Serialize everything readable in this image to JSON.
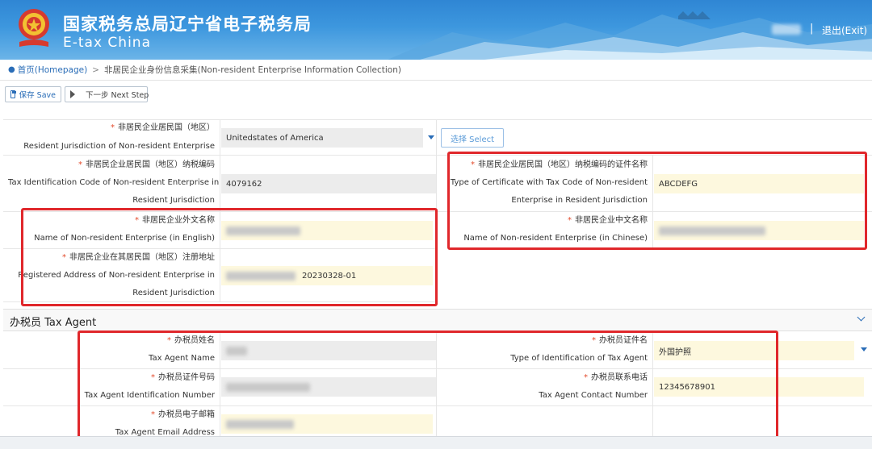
{
  "header": {
    "title_cn": "国家税务总局辽宁省电子税务局",
    "title_en": "E-tax China",
    "separator": "|",
    "exit_label": "退出(Exit)"
  },
  "breadcrumb": {
    "home": "首页(Homepage)",
    "arrow": ">",
    "current": "非居民企业身份信息采集(Non-resident Enterprise Information Collection)"
  },
  "toolbar": {
    "save_label": "保存 Save",
    "next_label": "下一步 Next Step"
  },
  "fields": {
    "jurisdiction": {
      "label_cn": "非居民企业居民国（地区）",
      "label_en": "Resident Jurisdiction of Non-resident Enterprise",
      "value": "Unitedstates of America",
      "select_label": "选择 Select"
    },
    "tax_id": {
      "label_cn": "非居民企业居民国（地区）纳税编码",
      "label_en1": "Tax Identification Code of Non-resident Enterprise in",
      "label_en2": "Resident Jurisdiction",
      "value": "4079162"
    },
    "cert_type": {
      "label_cn": "非居民企业居民国（地区）纳税编码的证件名称",
      "label_en1": "Type of Certificate with Tax Code of Non-resident",
      "label_en2": "Enterprise in Resident Jurisdiction",
      "value": "ABCDEFG"
    },
    "name_en": {
      "label_cn": "非居民企业外文名称",
      "label_en": "Name of Non-resident Enterprise (in English)"
    },
    "name_cn": {
      "label_cn": "非居民企业中文名称",
      "label_en": "Name of Non-resident Enterprise (in Chinese)"
    },
    "address": {
      "label_cn": "非居民企业在其居民国（地区）注册地址",
      "label_en1": "Registered Address of Non-resident Enterprise in",
      "label_en2": "Resident Jurisdiction",
      "value": "20230328-01"
    }
  },
  "tax_agent": {
    "section_title": "办税员 Tax Agent",
    "name": {
      "label_cn": "办税员姓名",
      "label_en": "Tax Agent Name"
    },
    "id_type": {
      "label_cn": "办税员证件名",
      "label_en": "Type of Identification of Tax Agent",
      "value": "外国护照"
    },
    "id_number": {
      "label_cn": "办税员证件号码",
      "label_en": "Tax Agent Identification Number"
    },
    "phone": {
      "label_cn": "办税员联系电话",
      "label_en": "Tax Agent Contact Number",
      "value": "12345678901"
    },
    "email": {
      "label_cn": "办税员电子邮箱",
      "label_en": "Tax Agent Email Address"
    }
  },
  "required_mark": "*",
  "colors": {
    "header_blue": "#3d97de",
    "link_blue": "#2a6db7",
    "required_red": "#e34b2c",
    "highlight_red": "#e0272b",
    "field_yellow": "#fdf8de"
  }
}
